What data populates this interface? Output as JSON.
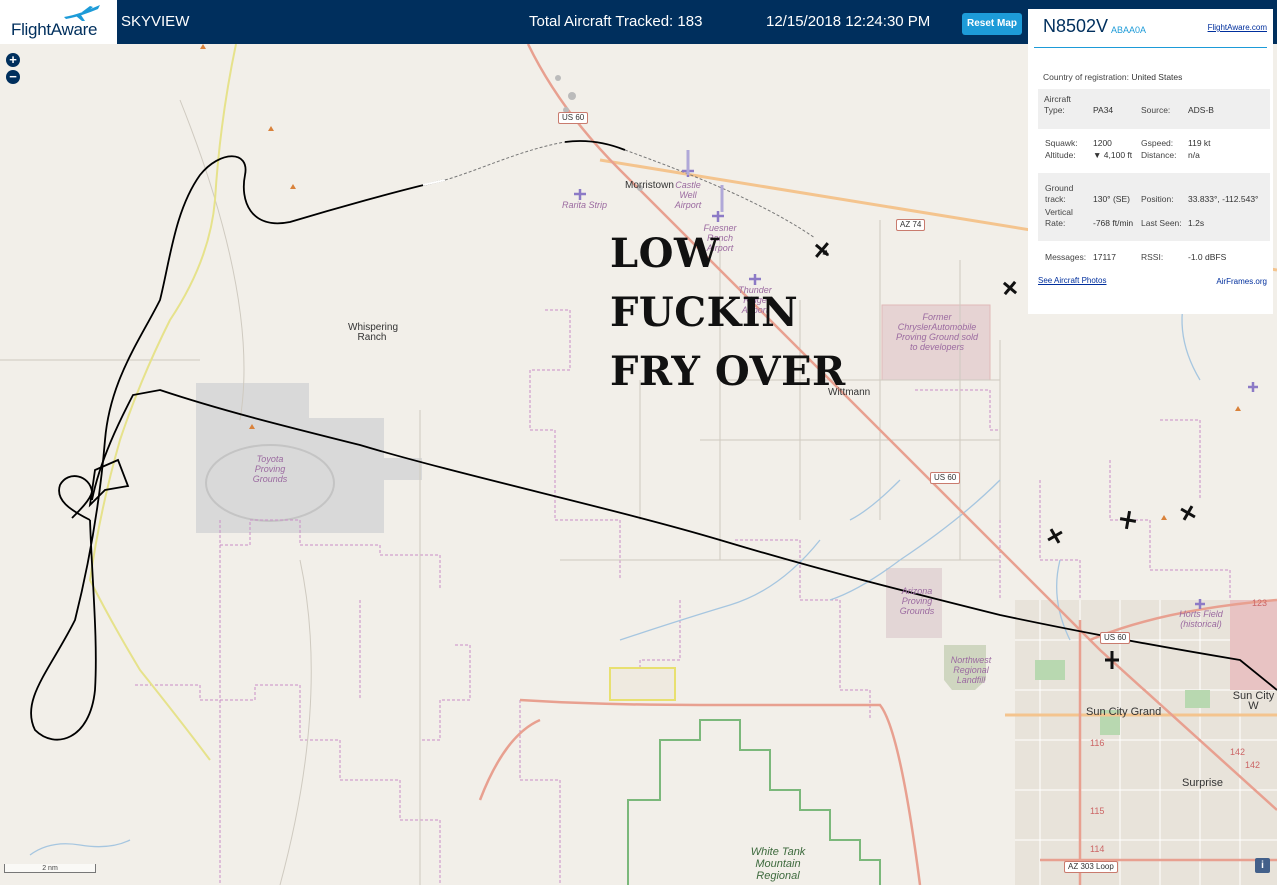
{
  "header": {
    "logo_text": "FlightAware",
    "app_title": "SKYVIEW",
    "tracked_label": "Total Aircraft Tracked: 183",
    "datetime": "12/15/2018 12:24:30 PM",
    "reset_label": "Reset Map"
  },
  "zoom": {
    "in": "+",
    "out": "−"
  },
  "overlay": {
    "line1": "LOW",
    "line2": "FUCKIN",
    "line3": "FRY OVER"
  },
  "map_labels": {
    "morristown": "Morristown",
    "castle_well": "Castle Well Airport",
    "rarita": "Rarita Strip",
    "fuesner": "Fuesner Ranch Airport",
    "thunder": "Thunder Ridge Airport",
    "whispering": "Whispering Ranch",
    "toyota": "Toyota Proving Grounds",
    "chrysler": "Former ChryslerAutomobile Proving Ground sold to developers",
    "wittmann": "Wittmann",
    "arizona_pg": "Arizona Proving Grounds",
    "landfill": "Northwest Regional Landfill",
    "horts": "Horts Field (historical)",
    "sun_city_grand": "Sun City Grand",
    "sun_city_w": "Sun City W",
    "surprise": "Surprise",
    "white_tank": "White Tank Mountain Regional",
    "us60_a": "US 60",
    "us60_b": "US 60",
    "us60_c": "US 60",
    "az74": "AZ 74",
    "az303": "AZ 303 Loop",
    "r142a": "142",
    "r142b": "142",
    "r123": "123",
    "r116": "116",
    "r115": "115",
    "r114": "114"
  },
  "panel": {
    "ident": "N8502V",
    "hex": "ABAA0A",
    "fa_link": "FlightAware.com",
    "country_label": "Country of registration:",
    "country_value": "United States",
    "type_label": "Aircraft Type:",
    "type_value": "PA34",
    "source_label": "Source:",
    "source_value": "ADS-B",
    "squawk_label": "Squawk:",
    "squawk_value": "1200",
    "gspeed_label": "Gspeed:",
    "gspeed_value": "119 kt",
    "altitude_label": "Altitude:",
    "altitude_value": "▼ 4,100 ft",
    "distance_label": "Distance:",
    "distance_value": "n/a",
    "track_label": "Ground track:",
    "track_value": "130° (SE)",
    "position_label": "Position:",
    "position_value": "33.833°, -112.543°",
    "vrate_label": "Vertical Rate:",
    "vrate_value": "-768 ft/min",
    "lastseen_label": "Last Seen:",
    "lastseen_value": "1.2s",
    "messages_label": "Messages:",
    "messages_value": "17117",
    "rssi_label": "RSSI:",
    "rssi_value": "-1.0 dBFS",
    "photos_link": "See Aircraft Photos",
    "airframes_link": "AirFrames.org"
  },
  "scale_label": "2 nm",
  "info_button": "i",
  "colors": {
    "header_bg": "#002f5d",
    "accent": "#1d9bd8",
    "map_bg": "#f2efe9"
  }
}
